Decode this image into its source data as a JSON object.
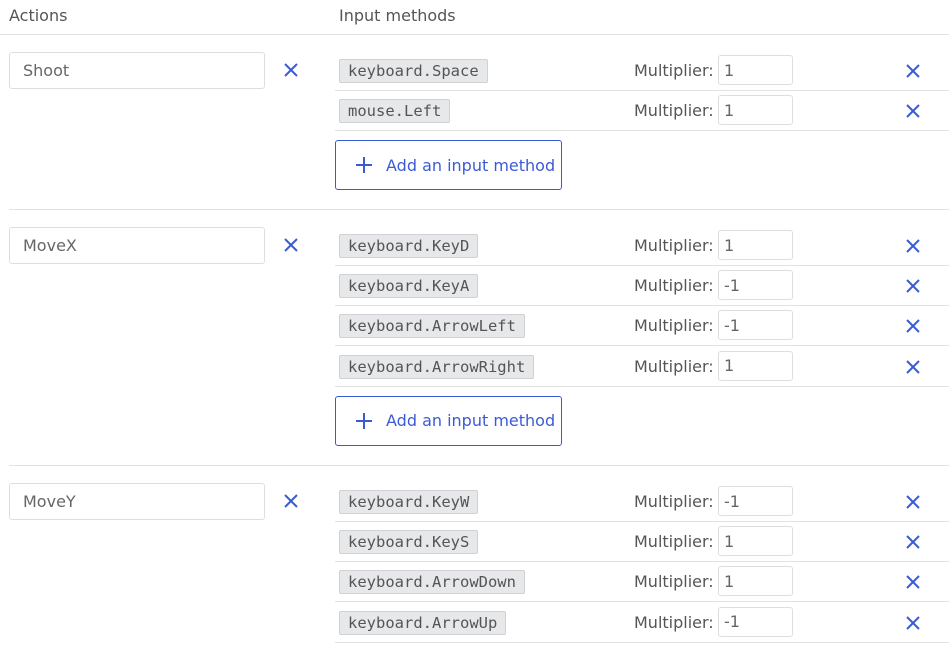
{
  "header": {
    "actions_label": "Actions",
    "input_methods_label": "Input methods"
  },
  "colors": {
    "accent": "#3b5bd6",
    "tag_bg": "#e7e8ea",
    "divider": "#e2e2e2"
  },
  "icons": {
    "remove": "close-icon",
    "add": "plus-icon"
  },
  "add_button_label": "Add an input method",
  "multiplier_label": "Multiplier:",
  "actions": [
    {
      "name": "Shoot",
      "methods": [
        {
          "key": "keyboard.Space",
          "multiplier": "1"
        },
        {
          "key": "mouse.Left",
          "multiplier": "1"
        }
      ]
    },
    {
      "name": "MoveX",
      "methods": [
        {
          "key": "keyboard.KeyD",
          "multiplier": "1"
        },
        {
          "key": "keyboard.KeyA",
          "multiplier": "-1"
        },
        {
          "key": "keyboard.ArrowLeft",
          "multiplier": "-1"
        },
        {
          "key": "keyboard.ArrowRight",
          "multiplier": "1"
        }
      ]
    },
    {
      "name": "MoveY",
      "methods": [
        {
          "key": "keyboard.KeyW",
          "multiplier": "-1"
        },
        {
          "key": "keyboard.KeyS",
          "multiplier": "1"
        },
        {
          "key": "keyboard.ArrowDown",
          "multiplier": "1"
        },
        {
          "key": "keyboard.ArrowUp",
          "multiplier": "-1"
        }
      ]
    }
  ]
}
